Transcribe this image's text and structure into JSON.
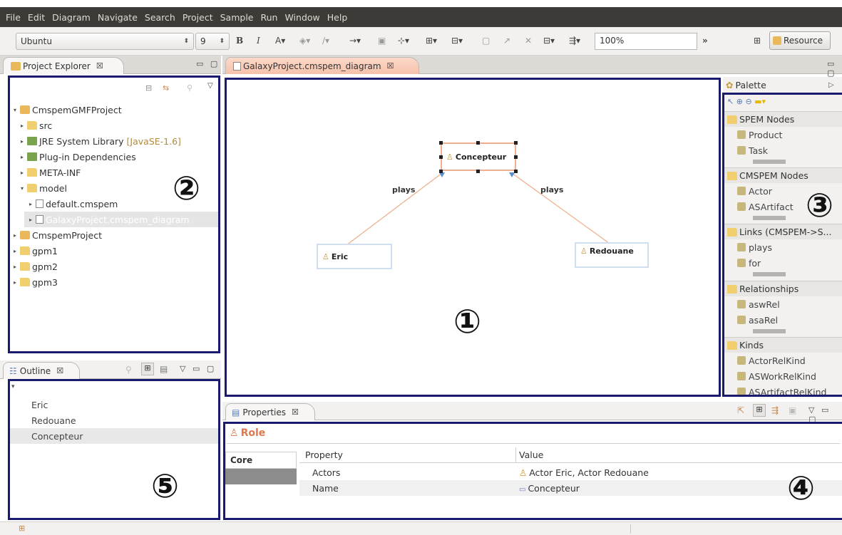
{
  "menu": [
    "File",
    "Edit",
    "Diagram",
    "Navigate",
    "Search",
    "Project",
    "Sample",
    "Run",
    "Window",
    "Help"
  ],
  "toolbar": {
    "font_family": "Ubuntu",
    "font_size": "9",
    "bold": "B",
    "italic": "I",
    "zoom": "100%",
    "overflow": "»",
    "perspective_label": "Resource"
  },
  "project_explorer": {
    "tab_label": "Project Explorer",
    "tree": [
      {
        "label": "CmspemGMFProject",
        "expanded": true
      },
      {
        "label": "src"
      },
      {
        "label": "JRE System Library",
        "tag": "[JavaSE-1.6]"
      },
      {
        "label": "Plug-in Dependencies"
      },
      {
        "label": "META-INF"
      },
      {
        "label": "model",
        "expanded": true
      },
      {
        "label": "default.cmspem"
      },
      {
        "label": "GalaxyProject.cmspem_diagram",
        "selected": true
      },
      {
        "label": "CmspemProject"
      },
      {
        "label": "gpm1"
      },
      {
        "label": "gpm2"
      },
      {
        "label": "gpm3"
      }
    ]
  },
  "editor": {
    "tab_label": "GalaxyProject.cmspem_diagram",
    "nodes": {
      "concepteur": "Concepteur",
      "eric": "Eric",
      "redouane": "Redouane"
    },
    "edges": {
      "left": "plays",
      "right": "plays"
    }
  },
  "palette": {
    "title": "Palette",
    "groups": [
      {
        "name": "SPEM Nodes",
        "items": [
          "Product",
          "Task"
        ]
      },
      {
        "name": "CMSPEM Nodes",
        "items": [
          "Actor",
          "ASArtifact"
        ]
      },
      {
        "name": "Links (CMSPEM->S...",
        "items": [
          "plays",
          "for"
        ]
      },
      {
        "name": "Relationships",
        "items": [
          "aswRel",
          "asaRel"
        ]
      },
      {
        "name": "Kinds",
        "items": [
          "ActorRelKind",
          "ASWorkRelKind",
          "ASArtifactRelKind"
        ]
      }
    ]
  },
  "outline": {
    "tab_label": "Outline",
    "items": [
      "Eric",
      "Redouane",
      "Concepteur"
    ]
  },
  "properties": {
    "tab_label": "Properties",
    "title": "Role",
    "section_tab": "Core",
    "columns": [
      "Property",
      "Value"
    ],
    "rows": [
      {
        "property": "Actors",
        "value": "Actor Eric, Actor Redouane"
      },
      {
        "property": "Name",
        "value": "Concepteur"
      }
    ]
  },
  "callouts": [
    "①",
    "②",
    "③",
    "④",
    "⑤"
  ]
}
